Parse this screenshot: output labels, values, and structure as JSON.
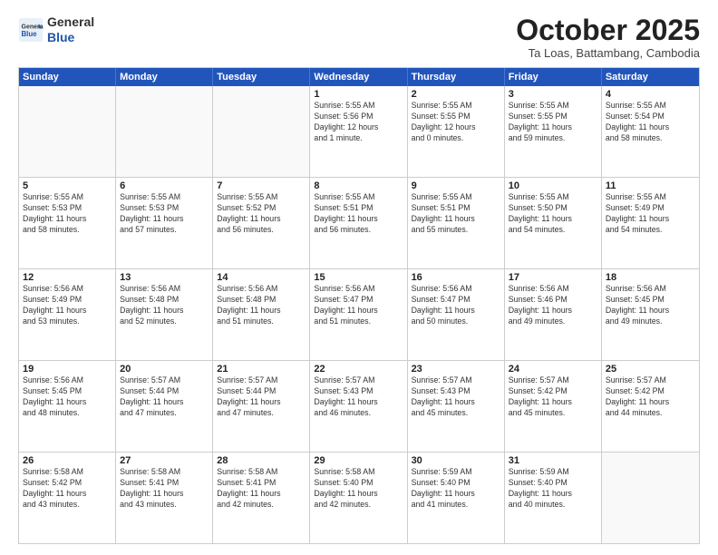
{
  "header": {
    "logo_general": "General",
    "logo_blue": "Blue",
    "month_title": "October 2025",
    "location": "Ta Loas, Battambang, Cambodia"
  },
  "weekdays": [
    "Sunday",
    "Monday",
    "Tuesday",
    "Wednesday",
    "Thursday",
    "Friday",
    "Saturday"
  ],
  "rows": [
    [
      {
        "day": "",
        "content": ""
      },
      {
        "day": "",
        "content": ""
      },
      {
        "day": "",
        "content": ""
      },
      {
        "day": "1",
        "content": "Sunrise: 5:55 AM\nSunset: 5:56 PM\nDaylight: 12 hours\nand 1 minute."
      },
      {
        "day": "2",
        "content": "Sunrise: 5:55 AM\nSunset: 5:55 PM\nDaylight: 12 hours\nand 0 minutes."
      },
      {
        "day": "3",
        "content": "Sunrise: 5:55 AM\nSunset: 5:55 PM\nDaylight: 11 hours\nand 59 minutes."
      },
      {
        "day": "4",
        "content": "Sunrise: 5:55 AM\nSunset: 5:54 PM\nDaylight: 11 hours\nand 58 minutes."
      }
    ],
    [
      {
        "day": "5",
        "content": "Sunrise: 5:55 AM\nSunset: 5:53 PM\nDaylight: 11 hours\nand 58 minutes."
      },
      {
        "day": "6",
        "content": "Sunrise: 5:55 AM\nSunset: 5:53 PM\nDaylight: 11 hours\nand 57 minutes."
      },
      {
        "day": "7",
        "content": "Sunrise: 5:55 AM\nSunset: 5:52 PM\nDaylight: 11 hours\nand 56 minutes."
      },
      {
        "day": "8",
        "content": "Sunrise: 5:55 AM\nSunset: 5:51 PM\nDaylight: 11 hours\nand 56 minutes."
      },
      {
        "day": "9",
        "content": "Sunrise: 5:55 AM\nSunset: 5:51 PM\nDaylight: 11 hours\nand 55 minutes."
      },
      {
        "day": "10",
        "content": "Sunrise: 5:55 AM\nSunset: 5:50 PM\nDaylight: 11 hours\nand 54 minutes."
      },
      {
        "day": "11",
        "content": "Sunrise: 5:55 AM\nSunset: 5:49 PM\nDaylight: 11 hours\nand 54 minutes."
      }
    ],
    [
      {
        "day": "12",
        "content": "Sunrise: 5:56 AM\nSunset: 5:49 PM\nDaylight: 11 hours\nand 53 minutes."
      },
      {
        "day": "13",
        "content": "Sunrise: 5:56 AM\nSunset: 5:48 PM\nDaylight: 11 hours\nand 52 minutes."
      },
      {
        "day": "14",
        "content": "Sunrise: 5:56 AM\nSunset: 5:48 PM\nDaylight: 11 hours\nand 51 minutes."
      },
      {
        "day": "15",
        "content": "Sunrise: 5:56 AM\nSunset: 5:47 PM\nDaylight: 11 hours\nand 51 minutes."
      },
      {
        "day": "16",
        "content": "Sunrise: 5:56 AM\nSunset: 5:47 PM\nDaylight: 11 hours\nand 50 minutes."
      },
      {
        "day": "17",
        "content": "Sunrise: 5:56 AM\nSunset: 5:46 PM\nDaylight: 11 hours\nand 49 minutes."
      },
      {
        "day": "18",
        "content": "Sunrise: 5:56 AM\nSunset: 5:45 PM\nDaylight: 11 hours\nand 49 minutes."
      }
    ],
    [
      {
        "day": "19",
        "content": "Sunrise: 5:56 AM\nSunset: 5:45 PM\nDaylight: 11 hours\nand 48 minutes."
      },
      {
        "day": "20",
        "content": "Sunrise: 5:57 AM\nSunset: 5:44 PM\nDaylight: 11 hours\nand 47 minutes."
      },
      {
        "day": "21",
        "content": "Sunrise: 5:57 AM\nSunset: 5:44 PM\nDaylight: 11 hours\nand 47 minutes."
      },
      {
        "day": "22",
        "content": "Sunrise: 5:57 AM\nSunset: 5:43 PM\nDaylight: 11 hours\nand 46 minutes."
      },
      {
        "day": "23",
        "content": "Sunrise: 5:57 AM\nSunset: 5:43 PM\nDaylight: 11 hours\nand 45 minutes."
      },
      {
        "day": "24",
        "content": "Sunrise: 5:57 AM\nSunset: 5:42 PM\nDaylight: 11 hours\nand 45 minutes."
      },
      {
        "day": "25",
        "content": "Sunrise: 5:57 AM\nSunset: 5:42 PM\nDaylight: 11 hours\nand 44 minutes."
      }
    ],
    [
      {
        "day": "26",
        "content": "Sunrise: 5:58 AM\nSunset: 5:42 PM\nDaylight: 11 hours\nand 43 minutes."
      },
      {
        "day": "27",
        "content": "Sunrise: 5:58 AM\nSunset: 5:41 PM\nDaylight: 11 hours\nand 43 minutes."
      },
      {
        "day": "28",
        "content": "Sunrise: 5:58 AM\nSunset: 5:41 PM\nDaylight: 11 hours\nand 42 minutes."
      },
      {
        "day": "29",
        "content": "Sunrise: 5:58 AM\nSunset: 5:40 PM\nDaylight: 11 hours\nand 42 minutes."
      },
      {
        "day": "30",
        "content": "Sunrise: 5:59 AM\nSunset: 5:40 PM\nDaylight: 11 hours\nand 41 minutes."
      },
      {
        "day": "31",
        "content": "Sunrise: 5:59 AM\nSunset: 5:40 PM\nDaylight: 11 hours\nand 40 minutes."
      },
      {
        "day": "",
        "content": ""
      }
    ]
  ]
}
